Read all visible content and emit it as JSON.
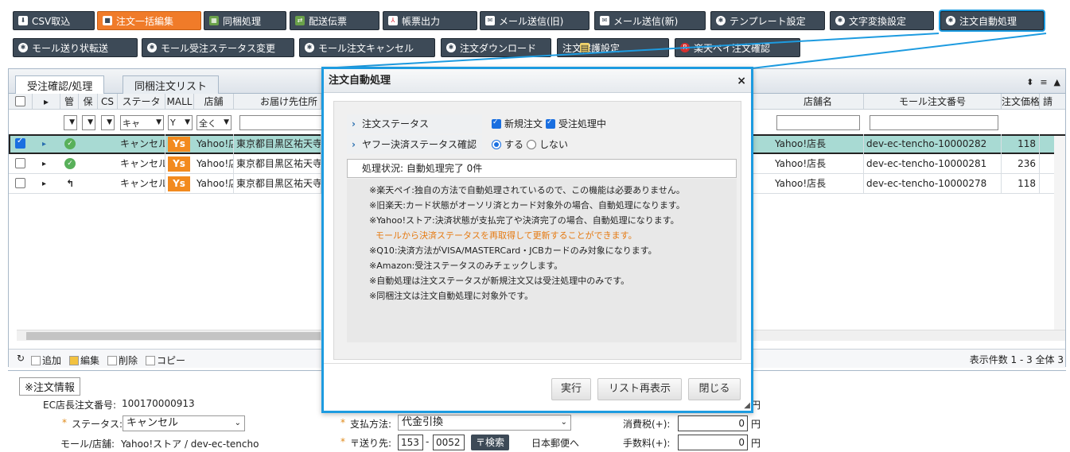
{
  "toolbar": {
    "row1": [
      {
        "label": "CSV取込",
        "icon": "download-icon"
      },
      {
        "label": "注文一括編集",
        "icon": "edit-icon"
      },
      {
        "label": "同梱処理",
        "icon": "bundle-icon"
      },
      {
        "label": "配送伝票",
        "icon": "slip-icon"
      },
      {
        "label": "帳票出力",
        "icon": "pdf-icon"
      },
      {
        "label": "メール送信(旧)",
        "icon": "mail-icon"
      },
      {
        "label": "メール送信(新)",
        "icon": "mail-icon"
      },
      {
        "label": "テンプレート設定",
        "icon": "gear-icon"
      },
      {
        "label": "文字変換設定",
        "icon": "gear-icon"
      },
      {
        "label": "注文自動処理",
        "icon": "gear-icon"
      }
    ],
    "row2": [
      {
        "label": "モール送り状転送",
        "icon": "gear-icon"
      },
      {
        "label": "モール受注ステータス変更",
        "icon": "gear-icon"
      },
      {
        "label": "モール注文キャンセル",
        "icon": "gear-icon"
      },
      {
        "label": "注文ダウンロード",
        "icon": "gear-icon"
      },
      {
        "label": "注文保護設定",
        "icon": "note-icon"
      },
      {
        "label": "楽天ペイ注文確認",
        "icon": "rakuten-icon"
      }
    ]
  },
  "tabs": [
    "受注確認/処理",
    "同梱注文リスト"
  ],
  "grid": {
    "headers_left": [
      "管",
      "保",
      "CS",
      "ステータ",
      "MALL",
      "店舗",
      "お届け先住所"
    ],
    "headers_right": [
      "店舗名",
      "モール注文番号",
      "注文価格",
      "請"
    ],
    "filters": {
      "status": "キャ",
      "mall": "Y",
      "store": "全く"
    },
    "rows": [
      {
        "status": "キャンセル",
        "mall": "Ys",
        "store": "Yahoo!店",
        "address": "東京都目黒区祐天寺",
        "store_name": "Yahoo!店長",
        "order_no": "dev-ec-tencho-10000282",
        "price": "118"
      },
      {
        "status": "キャンセル",
        "mall": "Ys",
        "store": "Yahoo!店",
        "address": "東京都目黒区祐天寺",
        "store_name": "Yahoo!店長",
        "order_no": "dev-ec-tencho-10000281",
        "price": "236"
      },
      {
        "status": "キャンセル",
        "mall": "Ys",
        "store": "Yahoo!店",
        "address": "東京都目黒区祐天寺",
        "store_name": "Yahoo!店長",
        "order_no": "dev-ec-tencho-10000278",
        "price": "118"
      }
    ]
  },
  "pager": {
    "add": "追加",
    "edit": "編集",
    "delete": "削除",
    "copy": "コピー",
    "count": "表示件数 1 - 3 全体 3"
  },
  "detail": {
    "legend": "※注文情報",
    "ec_no_label": "EC店長注文番号:",
    "ec_no_value": "100170000913",
    "status_label": "ステータス:",
    "status_value": "キャンセル",
    "mall_label": "モール/店舗:",
    "mall_value": "Yahoo!ストア / dev-ec-tencho",
    "pay_label": "支払方法:",
    "pay_value": "代金引換",
    "zip_label": "〒送り先:",
    "zip1": "153",
    "zip2": "0052",
    "zip_search": "〒検索",
    "carrier": "日本郵便へ",
    "yen1": "円",
    "tax_label": "消費税(+):",
    "tax_value": "0",
    "tax_unit": "円",
    "fee_label": "手数料(+):",
    "fee_value": "0",
    "fee_unit": "円"
  },
  "modal": {
    "title": "注文自動処理",
    "close": "×",
    "field1_label": "注文ステータス",
    "field1_opt1": "新規注文",
    "field1_opt2": "受注処理中",
    "field2_label": "ヤフー決済ステータス確認",
    "field2_opt1": "する",
    "field2_opt2": "しない",
    "status_text": "処理状況: 自動処理完了  0件",
    "notes": [
      {
        "text": "※楽天ペイ:独自の方法で自動処理されているので、この機能は必要ありません。",
        "color": "normal"
      },
      {
        "text": "※旧楽天:カード状態がオーソリ済とカード対象外の場合、自動処理になります。",
        "color": "normal"
      },
      {
        "text": "※Yahoo!ストア:決済状態が支払完了や決済完了の場合、自動処理になります。",
        "color": "normal"
      },
      {
        "text": "モールから決済ステータスを再取得して更新することができます。",
        "color": "orange"
      },
      {
        "text": "※Q10:決済方法がVISA/MASTERCard・JCBカードのみ対象になります。",
        "color": "normal"
      },
      {
        "text": "※Amazon:受注ステータスのみチェックします。",
        "color": "normal"
      },
      {
        "text": "※自動処理は注文ステータスが新規注文又は受注処理中のみです。",
        "color": "normal"
      },
      {
        "text": "※同梱注文は注文自動処理に対象外です。",
        "color": "normal"
      }
    ],
    "btn_run": "実行",
    "btn_refresh": "リスト再表示",
    "btn_close": "閉じる"
  },
  "colors": {
    "accent": "#1d9be0",
    "toolbar": "#3d4a57",
    "active": "#f07b29",
    "selected_row": "#a8dad3"
  }
}
